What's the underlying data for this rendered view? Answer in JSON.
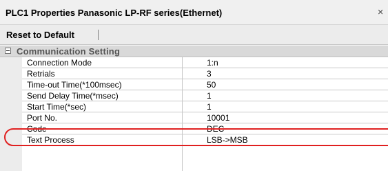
{
  "window": {
    "title": "PLC1 Properties Panasonic LP-RF series(Ethernet)",
    "close_symbol": "×"
  },
  "toolbar": {
    "reset_label": "Reset to Default"
  },
  "category": {
    "label": "Communication Setting",
    "toggle_icon": "collapse-minus"
  },
  "properties": [
    {
      "name": "Connection Mode",
      "value": "1:n"
    },
    {
      "name": "Retrials",
      "value": "3"
    },
    {
      "name": "Time-out Time(*100msec)",
      "value": "50"
    },
    {
      "name": "Send Delay Time(*msec)",
      "value": "1"
    },
    {
      "name": "Start Time(*sec)",
      "value": "1"
    },
    {
      "name": "Port No.",
      "value": "10001"
    },
    {
      "name": "Code",
      "value": "DEC"
    },
    {
      "name": "Text Process",
      "value": "LSB->MSB"
    }
  ],
  "colors": {
    "highlight": "#e02020",
    "category_bg": "#d9d9d9"
  }
}
